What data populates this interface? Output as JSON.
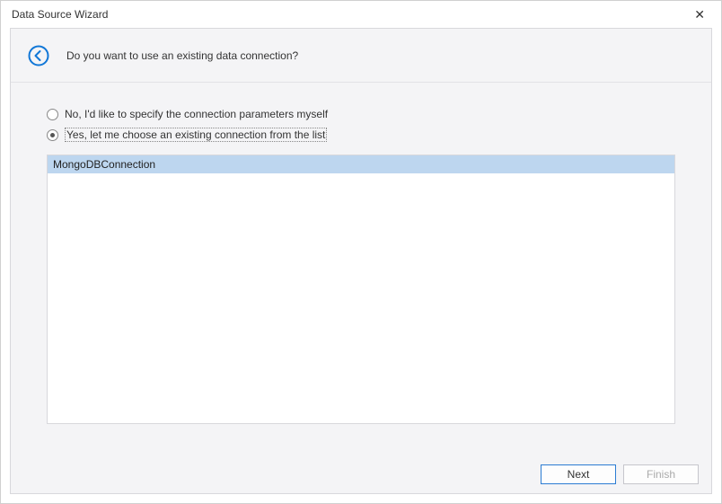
{
  "window": {
    "title": "Data Source Wizard",
    "close_glyph": "✕"
  },
  "header": {
    "question": "Do you want to use an existing data connection?"
  },
  "options": {
    "no_label": "No, I'd like to specify the connection parameters myself",
    "yes_label": "Yes, let me choose an existing connection from the list",
    "selected": "yes"
  },
  "connections": {
    "items": [
      "MongoDBConnection"
    ],
    "selected_index": 0
  },
  "footer": {
    "next_label": "Next",
    "finish_label": "Finish"
  }
}
